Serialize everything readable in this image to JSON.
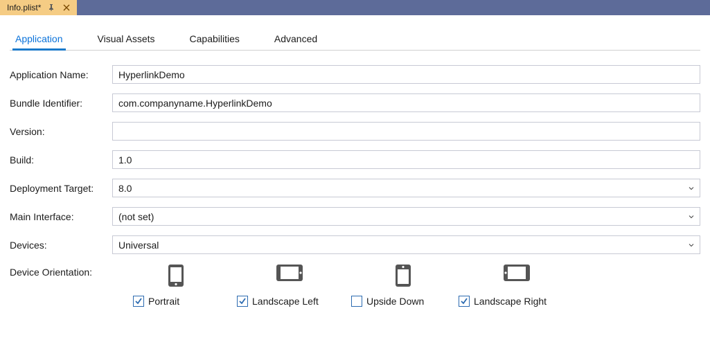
{
  "titlebar": {
    "file_tab": "Info.plist*"
  },
  "tabs": {
    "items": [
      {
        "label": "Application",
        "active": true
      },
      {
        "label": "Visual Assets",
        "active": false
      },
      {
        "label": "Capabilities",
        "active": false
      },
      {
        "label": "Advanced",
        "active": false
      }
    ]
  },
  "form": {
    "app_name": {
      "label": "Application Name:",
      "value": "HyperlinkDemo"
    },
    "bundle_id": {
      "label": "Bundle Identifier:",
      "value": "com.companyname.HyperlinkDemo"
    },
    "version": {
      "label": "Version:",
      "value": ""
    },
    "build": {
      "label": "Build:",
      "value": "1.0"
    },
    "deployment": {
      "label": "Deployment Target:",
      "value": "8.0"
    },
    "main_interface": {
      "label": "Main Interface:",
      "value": "(not set)"
    },
    "devices": {
      "label": "Devices:",
      "value": "Universal"
    },
    "orientation": {
      "label": "Device Orientation:",
      "options": [
        {
          "label": "Portrait",
          "checked": true
        },
        {
          "label": "Landscape Left",
          "checked": true
        },
        {
          "label": "Upside Down",
          "checked": false
        },
        {
          "label": "Landscape Right",
          "checked": true
        }
      ]
    }
  }
}
